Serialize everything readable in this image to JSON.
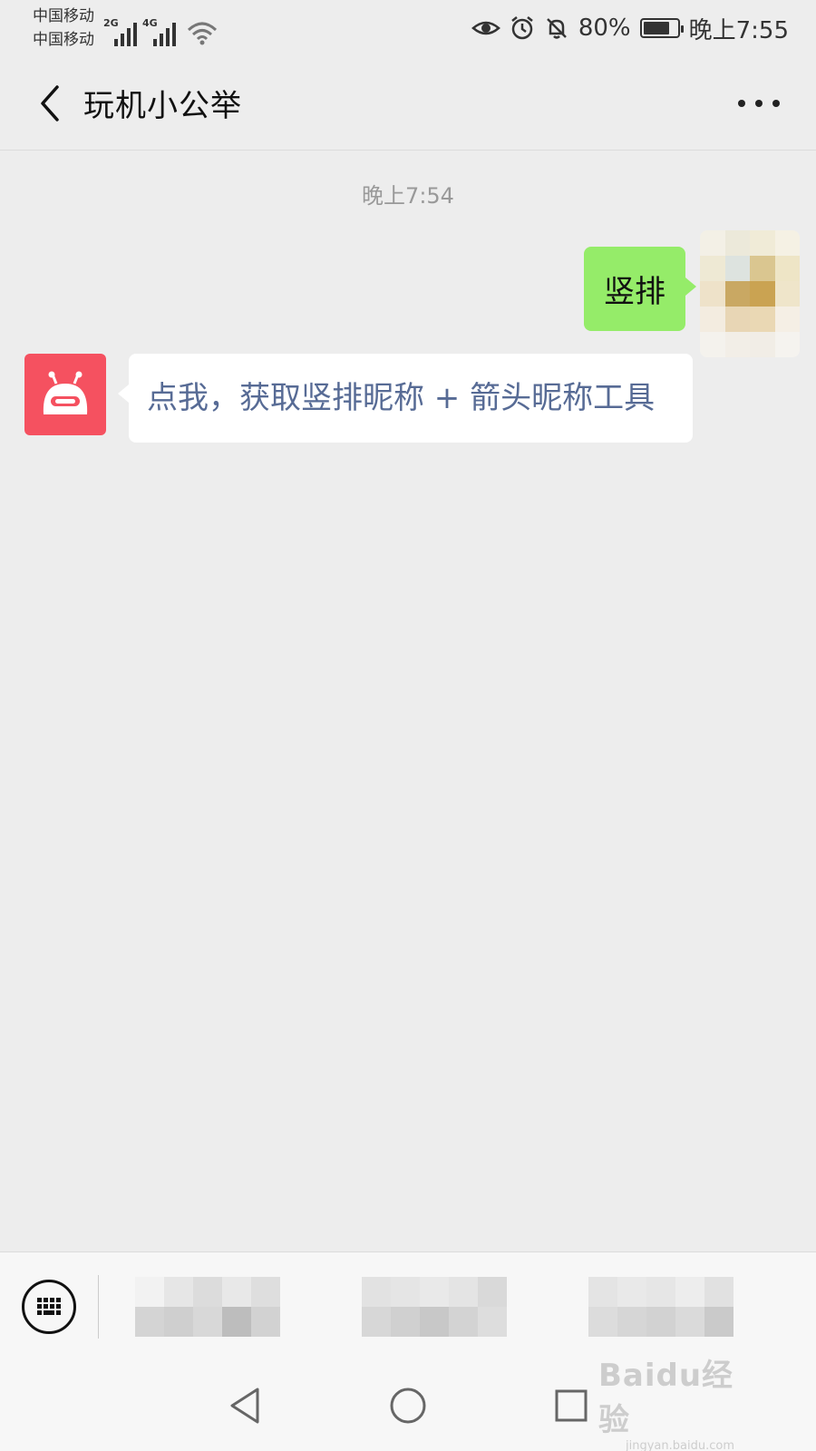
{
  "status_bar": {
    "carrier_1": "中国移动",
    "carrier_2": "中国移动",
    "network_1": "2G",
    "network_2": "4G",
    "battery": "80%",
    "battery_level": 0.8,
    "time": "晚上7:55"
  },
  "header": {
    "title": "玩机小公举"
  },
  "chat": {
    "timestamp": "晚上7:54",
    "sent_message": "竖排",
    "received_message": "点我，获取竖排昵称 + 箭头昵称工具"
  },
  "watermark": {
    "main": "Baidu经验",
    "sub": "jingyan.baidu.com"
  },
  "colors": {
    "sent_bubble": "#95ec69",
    "received_link_text": "#576b95",
    "bot_avatar": "#f55160",
    "background": "#ededed"
  }
}
